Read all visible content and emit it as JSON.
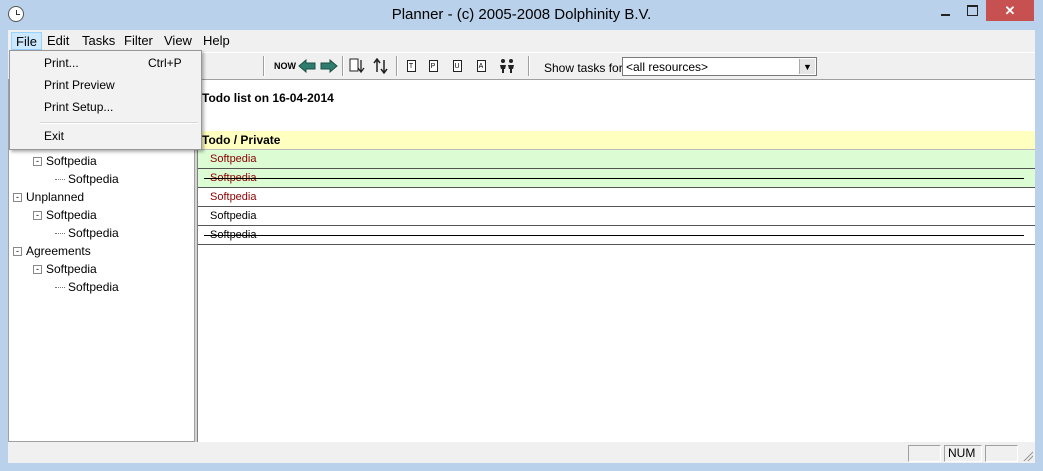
{
  "window": {
    "title": "Planner - (c) 2005-2008 Dolphinity B.V.",
    "close_glyph": "✕"
  },
  "menubar": {
    "items": [
      "File",
      "Edit",
      "Tasks",
      "Filter",
      "View",
      "Help"
    ],
    "active": "File"
  },
  "file_menu": {
    "items": [
      {
        "label": "Print...",
        "shortcut": "Ctrl+P"
      },
      {
        "label": "Print Preview",
        "shortcut": ""
      },
      {
        "label": "Print Setup...",
        "shortcut": ""
      },
      {
        "label": "Exit",
        "shortcut": ""
      }
    ]
  },
  "toolbar": {
    "now_label": "NOW",
    "show_tasks_label": "Show tasks for",
    "resource_select_value": "<all resources>",
    "doc_icons": [
      "T",
      "P",
      "U",
      "A"
    ]
  },
  "tree": {
    "nodes": [
      {
        "label": "Softpedia",
        "level": 1,
        "expander": "-"
      },
      {
        "label": "Softpedia",
        "level": 2,
        "expander": ""
      },
      {
        "label": "Unplanned",
        "level": 0,
        "expander": "-"
      },
      {
        "label": "Softpedia",
        "level": 1,
        "expander": "-"
      },
      {
        "label": "Softpedia",
        "level": 2,
        "expander": ""
      },
      {
        "label": "Agreements",
        "level": 0,
        "expander": "-"
      },
      {
        "label": "Softpedia",
        "level": 1,
        "expander": "-"
      },
      {
        "label": "Softpedia",
        "level": 2,
        "expander": ""
      }
    ]
  },
  "main": {
    "header": "Todo list on 16-04-2014",
    "group": "Todo / Private",
    "tasks": [
      {
        "label": "Softpedia",
        "color": "#8b0000",
        "highlight": true,
        "done": false
      },
      {
        "label": "Softpedia",
        "color": "#8b0000",
        "highlight": true,
        "done": true
      },
      {
        "label": "Softpedia",
        "color": "#8b0000",
        "highlight": false,
        "done": false
      },
      {
        "label": "Softpedia",
        "color": "#000000",
        "highlight": false,
        "done": false
      },
      {
        "label": "Softpedia",
        "color": "#000000",
        "highlight": false,
        "done": true
      }
    ]
  },
  "statusbar": {
    "panes": [
      "",
      "NUM",
      ""
    ]
  },
  "colors": {
    "titlebar": "#b9d1ea",
    "group_row": "#ffffc0",
    "highlight_row": "#dcfcd4",
    "task_red": "#8b0000"
  }
}
